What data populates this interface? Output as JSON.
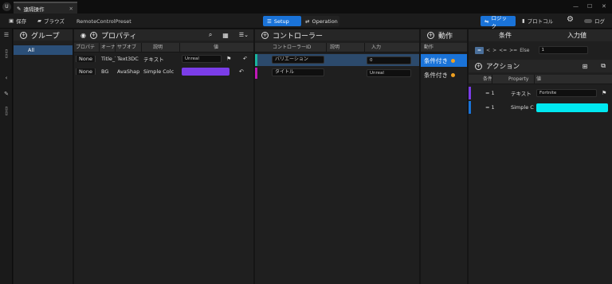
{
  "tab": {
    "title": "遠隔操作"
  },
  "toolbar": {
    "save": "保存",
    "browse": "ブラウズ",
    "preset": "RemoteControlPreset",
    "setup": "Setup",
    "operation": "Operation",
    "logic": "ロジック",
    "protocol": "プロトコル",
    "log": "ログ"
  },
  "colors": {
    "accent": "#1a73d8",
    "purple": "#7b3de8",
    "cyan": "#00e8f0",
    "teal": "#19b39e",
    "magenta": "#c018b8",
    "orange": "#f0a020"
  },
  "groups": {
    "title": "グループ",
    "items": [
      "All"
    ]
  },
  "properties": {
    "title": "プロパティ",
    "columns": [
      "プロパテ",
      "オーナ",
      "サブオブ",
      "説明",
      "値"
    ],
    "rows": [
      {
        "expose": "None",
        "owner": "Title_T",
        "sub": "Text3DC",
        "desc": "テキスト",
        "value": "Unreal"
      },
      {
        "expose": "None",
        "owner": "BG",
        "sub": "AvaShap",
        "desc": "Simple Colc",
        "value": ""
      }
    ]
  },
  "controllers": {
    "title": "コントローラー",
    "columns": [
      "コントローラーID",
      "説明",
      "入力"
    ],
    "rows": [
      {
        "id": "バリエーション",
        "input": "0"
      },
      {
        "id": "タイトル",
        "input": "Unreal"
      }
    ]
  },
  "actions": {
    "title": "動作",
    "column": "動作",
    "rows": [
      "条件付き",
      "条件付き"
    ]
  },
  "logic": {
    "condition_header": "条件",
    "input_header": "入力値",
    "ops": [
      "=",
      "<",
      ">",
      "<=",
      ">=",
      "Else"
    ],
    "input_value": "1",
    "actions_title": "アクション",
    "columns": [
      "条件式",
      "Property",
      "値"
    ],
    "rows": [
      {
        "cond": "= 1",
        "prop": "テキスト",
        "value": "Fortnite"
      },
      {
        "cond": "= 1",
        "prop": "Simple C",
        "value": ""
      }
    ]
  }
}
